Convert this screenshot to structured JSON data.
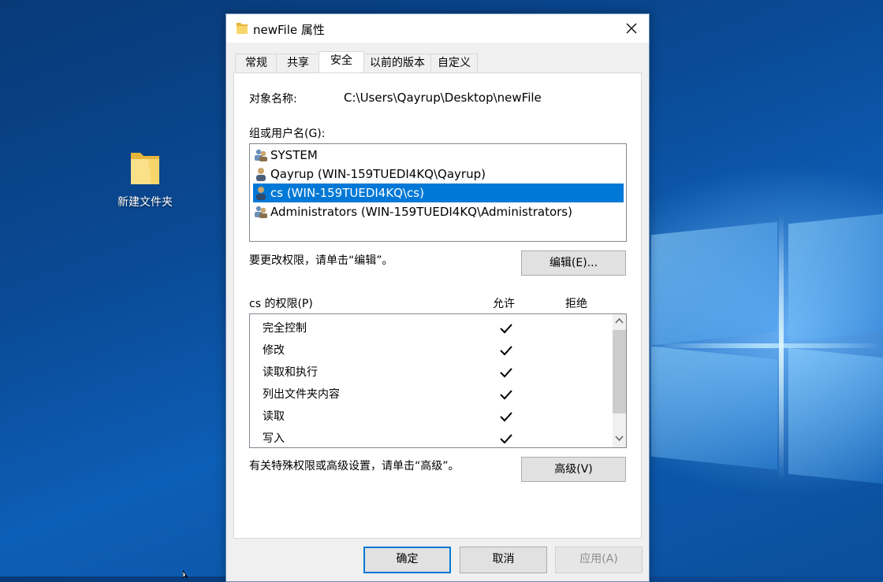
{
  "desktop": {
    "icon_label": "新建文件夹"
  },
  "dialog": {
    "title": "newFile 属性",
    "tabs": [
      {
        "label": "常规"
      },
      {
        "label": "共享"
      },
      {
        "label": "安全"
      },
      {
        "label": "以前的版本"
      },
      {
        "label": "自定义"
      }
    ],
    "active_tab": "安全",
    "object_name_label": "对象名称:",
    "object_name_value": "C:\\Users\\Qayrup\\Desktop\\newFile",
    "groups_label": "组或用户名(G):",
    "users": [
      {
        "label": "SYSTEM",
        "icon": "group-icon"
      },
      {
        "label": "Qayrup (WIN-159TUEDI4KQ\\Qayrup)",
        "icon": "user-icon"
      },
      {
        "label": "cs (WIN-159TUEDI4KQ\\cs)",
        "icon": "user-icon",
        "selected": true
      },
      {
        "label": "Administrators (WIN-159TUEDI4KQ\\Administrators)",
        "icon": "group-icon"
      }
    ],
    "change_perm_text": "要更改权限，请单击“编辑”。",
    "edit_button": "编辑(E)...",
    "perm_header": "cs 的权限(P)",
    "allow_header": "允许",
    "deny_header": "拒绝",
    "permissions": [
      {
        "label": "完全控制",
        "allow": true,
        "deny": false
      },
      {
        "label": "修改",
        "allow": true,
        "deny": false
      },
      {
        "label": "读取和执行",
        "allow": true,
        "deny": false
      },
      {
        "label": "列出文件夹内容",
        "allow": true,
        "deny": false
      },
      {
        "label": "读取",
        "allow": true,
        "deny": false
      },
      {
        "label": "写入",
        "allow": true,
        "deny": false
      }
    ],
    "advanced_text": "有关特殊权限或高级设置，请单击“高级”。",
    "advanced_button": "高级(V)",
    "ok_button": "确定",
    "cancel_button": "取消",
    "apply_button": "应用(A)"
  },
  "colors": {
    "selection": "#0078d7",
    "desktop_dark": "#083a78",
    "desktop_light": "#0d5eb6"
  }
}
